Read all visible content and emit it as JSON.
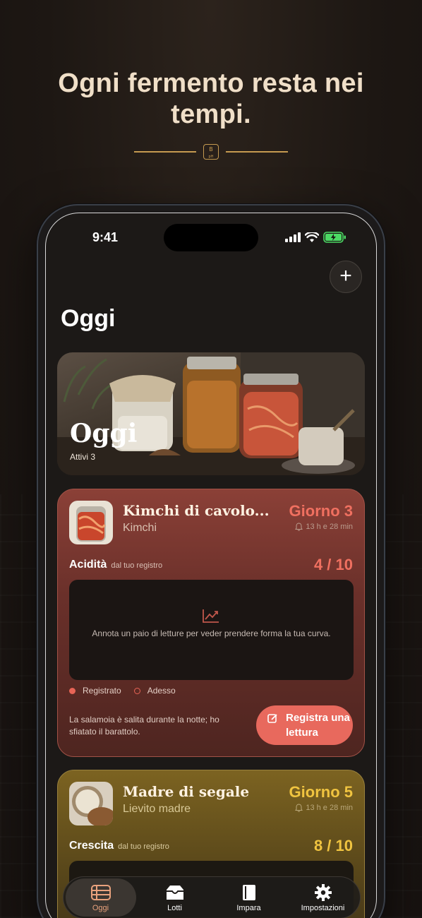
{
  "marketing": {
    "headline": "Ogni fermento resta nei tempi.",
    "badge_top": "B",
    "badge_bottom": "pH"
  },
  "status_bar": {
    "time": "9:41"
  },
  "header": {
    "title": "Oggi",
    "add_label": "+"
  },
  "hero": {
    "title": "Oggi",
    "subtitle": "Attivi  3"
  },
  "cards": [
    {
      "title": "Kimchi di cavolo...",
      "subtitle": "Kimchi",
      "day": "Giorno 3",
      "timer": "13 h e 28 min",
      "metric_label": "Acidità",
      "metric_source": "dal tuo registro",
      "metric_value": "4 / 10",
      "empty_chart_text": "Annota un paio di letture per veder prendere forma la tua curva.",
      "legend_logged": "Registrato",
      "legend_now": "Adesso",
      "note": "La salamoia è salita durante la notte; ho sfiatato il barattolo.",
      "cta": "Registra una lettura"
    },
    {
      "title": "Madre di segale",
      "subtitle": "Lievito madre",
      "day": "Giorno 5",
      "timer": "13 h e 28 min",
      "metric_label": "Crescita",
      "metric_source": "dal tuo registro",
      "metric_value": "8 / 10"
    }
  ],
  "tabbar": {
    "items": [
      {
        "label": "Oggi",
        "icon": "today-icon",
        "active": true
      },
      {
        "label": "Lotti",
        "icon": "tray-icon",
        "active": false
      },
      {
        "label": "Impara",
        "icon": "book-icon",
        "active": false
      },
      {
        "label": "Impostazioni",
        "icon": "gear-icon",
        "active": false
      }
    ]
  },
  "colors": {
    "accent_red": "#e8695d",
    "accent_gold": "#f0c440",
    "divider_gold": "#c59a50"
  }
}
